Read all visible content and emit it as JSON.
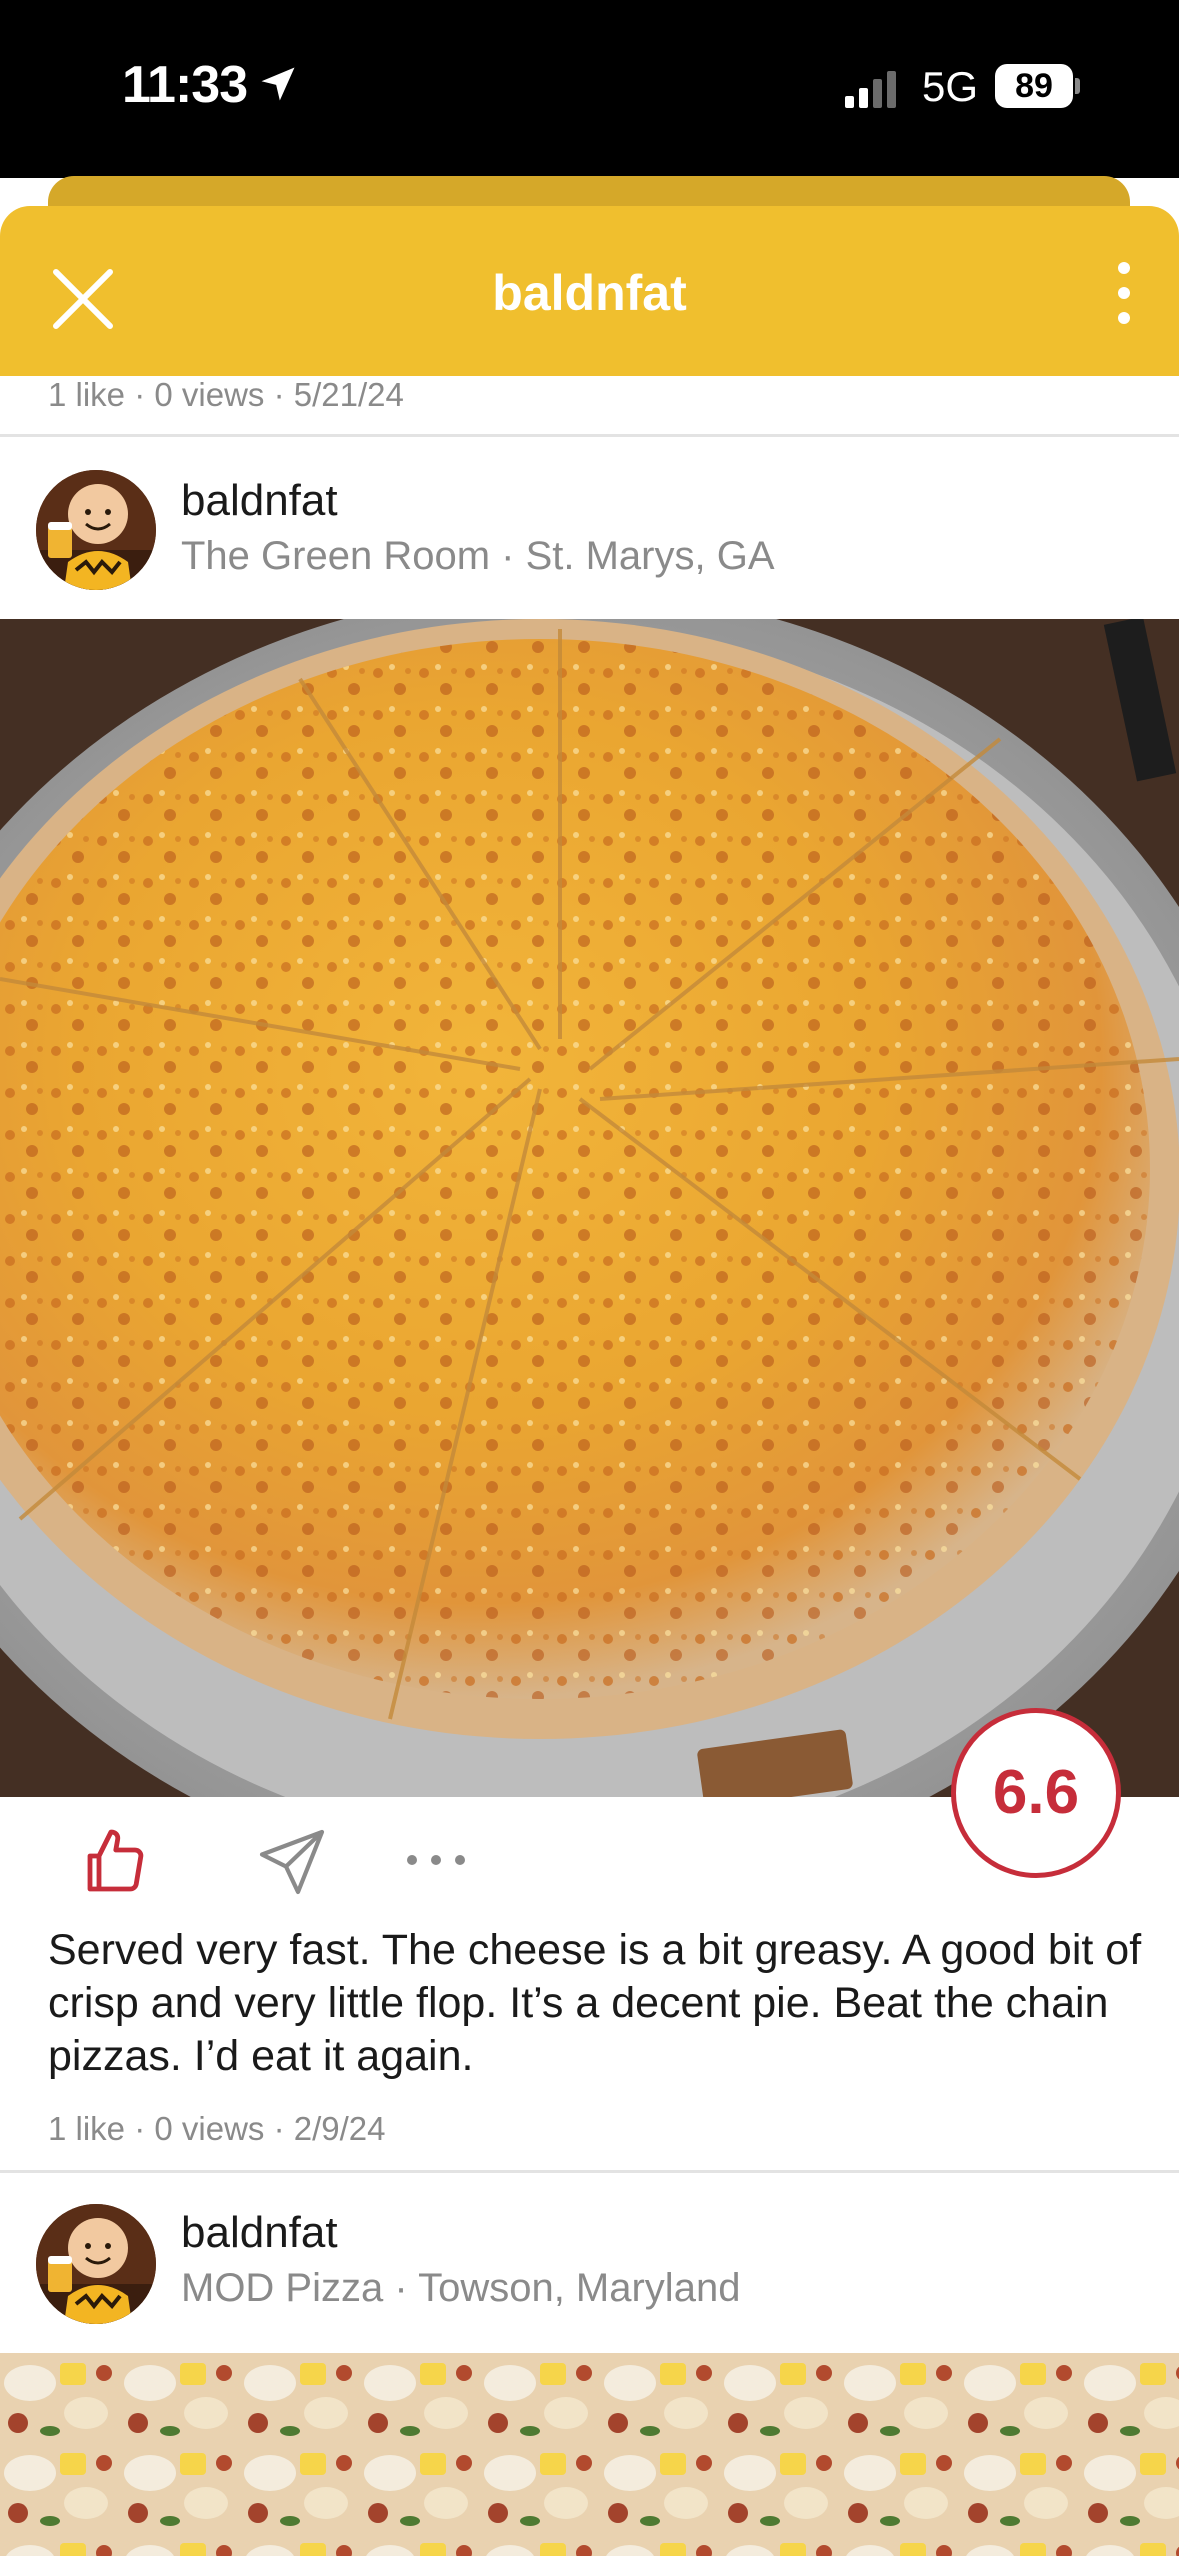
{
  "status_bar": {
    "time": "11:33",
    "network": "5G",
    "battery": "89"
  },
  "header": {
    "title": "baldnfat"
  },
  "posts": [
    {
      "meta": "1 like · 0 views · 5/21/24"
    },
    {
      "author": "baldnfat",
      "place": "The Green Room · St. Marys, GA",
      "score": "6.6",
      "review": "Served very fast. The cheese is a bit greasy. A good bit of crisp and very little flop. It’s a decent pie. Beat the chain pizzas. I’d eat it again.",
      "meta": "1 like · 0 views · 2/9/24"
    },
    {
      "author": "baldnfat",
      "place": "MOD Pizza · Towson, Maryland"
    }
  ],
  "colors": {
    "accent": "#f0bf2e",
    "score_red": "#c62d3a",
    "like_red": "#c62d3a"
  },
  "icons": [
    "location-arrow-icon",
    "signal-icon",
    "close-icon",
    "more-vertical-icon",
    "thumbs-up-icon",
    "send-icon",
    "more-horizontal-icon"
  ]
}
